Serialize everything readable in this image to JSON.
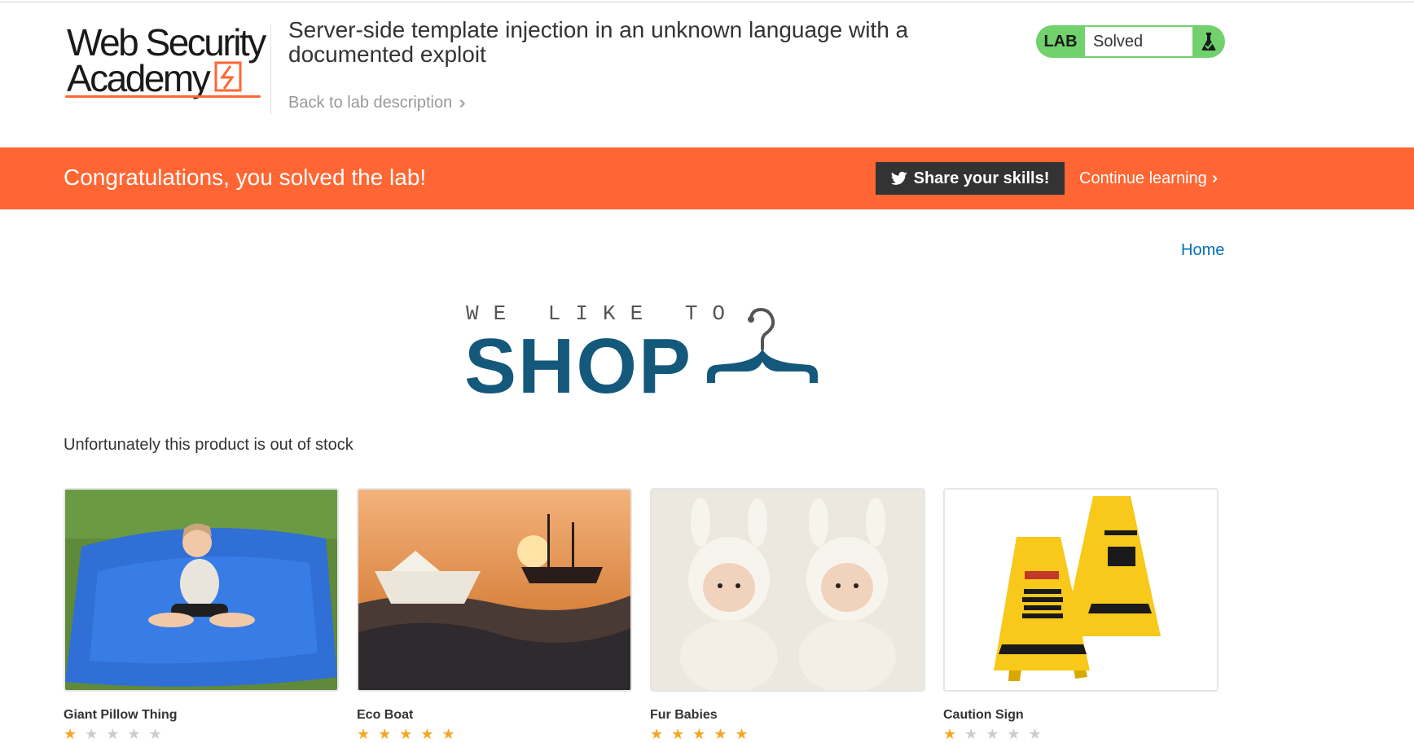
{
  "header": {
    "logo_line1": "Web Security",
    "logo_line2": "Academy",
    "lab_title": "Server-side template injection in an unknown language with a documented exploit",
    "back_link": "Back to lab description",
    "status_label": "LAB",
    "status_value": "Solved"
  },
  "banner": {
    "message": "Congratulations, you solved the lab!",
    "share_button": "Share your skills!",
    "continue_link": "Continue learning"
  },
  "nav": {
    "home": "Home"
  },
  "shop_logo": {
    "tagline": "WE LIKE TO",
    "word": "SHOP"
  },
  "stock_message": "Unfortunately this product is out of stock",
  "products": [
    {
      "name": "Giant Pillow Thing",
      "rating": 1
    },
    {
      "name": "Eco Boat",
      "rating": 5
    },
    {
      "name": "Fur Babies",
      "rating": 5
    },
    {
      "name": "Caution Sign",
      "rating": 1
    }
  ],
  "colors": {
    "accent": "#ff6633",
    "solved_green": "#70d16d",
    "shop_blue": "#14587c",
    "link_blue": "#0071bc"
  }
}
